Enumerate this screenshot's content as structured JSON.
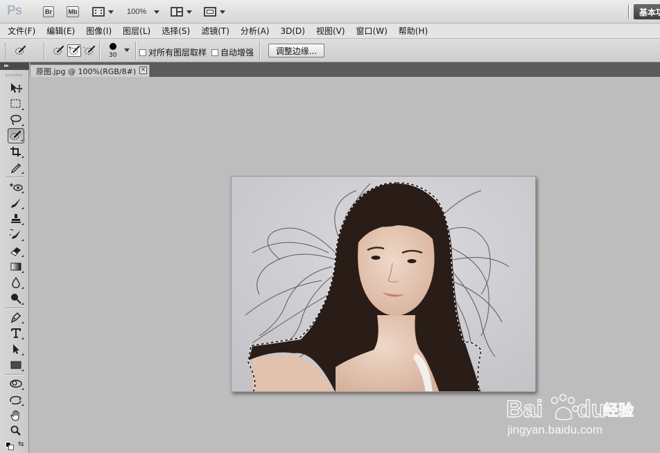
{
  "app": {
    "logo": "Ps",
    "bridge_label": "Br",
    "mini_bridge_label": "Mb",
    "zoom": "100%",
    "workspace": "基本功能"
  },
  "menu": [
    "文件(F)",
    "编辑(E)",
    "图像(I)",
    "图层(L)",
    "选择(S)",
    "滤镜(T)",
    "分析(A)",
    "3D(D)",
    "视图(V)",
    "窗口(W)",
    "帮助(H)"
  ],
  "options": {
    "tool_icon": "quick-selection-icon",
    "modes": [
      "new-selection",
      "add-to-selection",
      "subtract-from-selection"
    ],
    "selected_mode": "add-to-selection",
    "brush_size": "30",
    "sample_all_layers": {
      "label": "对所有图层取样",
      "checked": false
    },
    "auto_enhance": {
      "label": "自动增强",
      "checked": false
    },
    "refine_edge": "调整边缘..."
  },
  "document": {
    "tab_title": "原图.jpg @ 100%(RGB/8#)",
    "close": "×"
  },
  "tools": [
    "move",
    "marquee",
    "lasso",
    "quick-selection",
    "crop",
    "eyedropper",
    "spot-healing",
    "brush",
    "clone-stamp",
    "history-brush",
    "eraser",
    "gradient",
    "blur",
    "dodge",
    "pen",
    "type",
    "path-selection",
    "shape",
    "3d-rotate",
    "3d-orbit",
    "hand",
    "zoom"
  ],
  "active_tool": "quick-selection",
  "colors": {
    "foreground": "#000000",
    "background": "#ffffff",
    "canvas_bg": "#bdbdbd",
    "photo_bg": "#d3d2d7",
    "hair": "#2a1d17",
    "skin": "#e4c4b0",
    "watermark": "#ffffff"
  },
  "watermark": {
    "brand_left": "Bai",
    "brand_right": "du",
    "suffix": "经验",
    "url": "jingyan.baidu.com"
  }
}
